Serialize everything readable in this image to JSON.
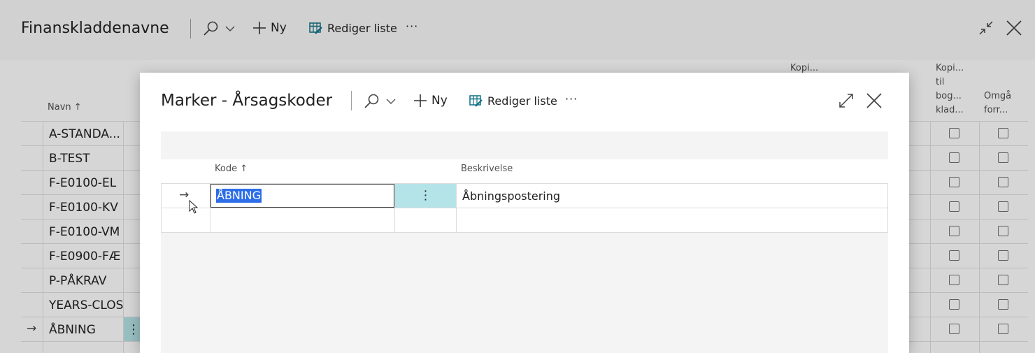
{
  "background": {
    "title": "Finanskladdenavne",
    "toolbar": {
      "new_label": "Ny",
      "edit_list_label": "Rediger liste",
      "more_label": "···"
    },
    "columns": {
      "navn": "Navn",
      "kopi1": "Kopi...",
      "kopi2_l1": "Kopi...",
      "kopi2_l2": "til",
      "kopi2_l3": "bog...",
      "kopi2_l4": "klad...",
      "omga_l1": "Omgå",
      "omga_l2": "forr..."
    },
    "rows": [
      "A-STANDA...",
      "B-TEST",
      "F-E0100-EL",
      "F-E0100-KV",
      "F-E0100-VM",
      "F-E0900-FÆ",
      "P-PÅKRAV",
      "YEARS-CLOS",
      "ÅBNING"
    ],
    "row_marker": "→",
    "row_dots": "⋮"
  },
  "modal": {
    "title": "Marker - Årsagskoder",
    "toolbar": {
      "new_label": "Ny",
      "edit_list_label": "Rediger liste",
      "more_label": "···"
    },
    "columns": {
      "kode": "Kode",
      "beskrivelse": "Beskrivelse"
    },
    "row": {
      "marker": "→",
      "kode": "ÅBNING",
      "dots": "⋮",
      "beskrivelse": "Åbningspostering"
    }
  },
  "colors": {
    "accent": "#2d6ee8",
    "selected_cell": "#b5e4e8",
    "icon_teal": "#0e6f85"
  }
}
